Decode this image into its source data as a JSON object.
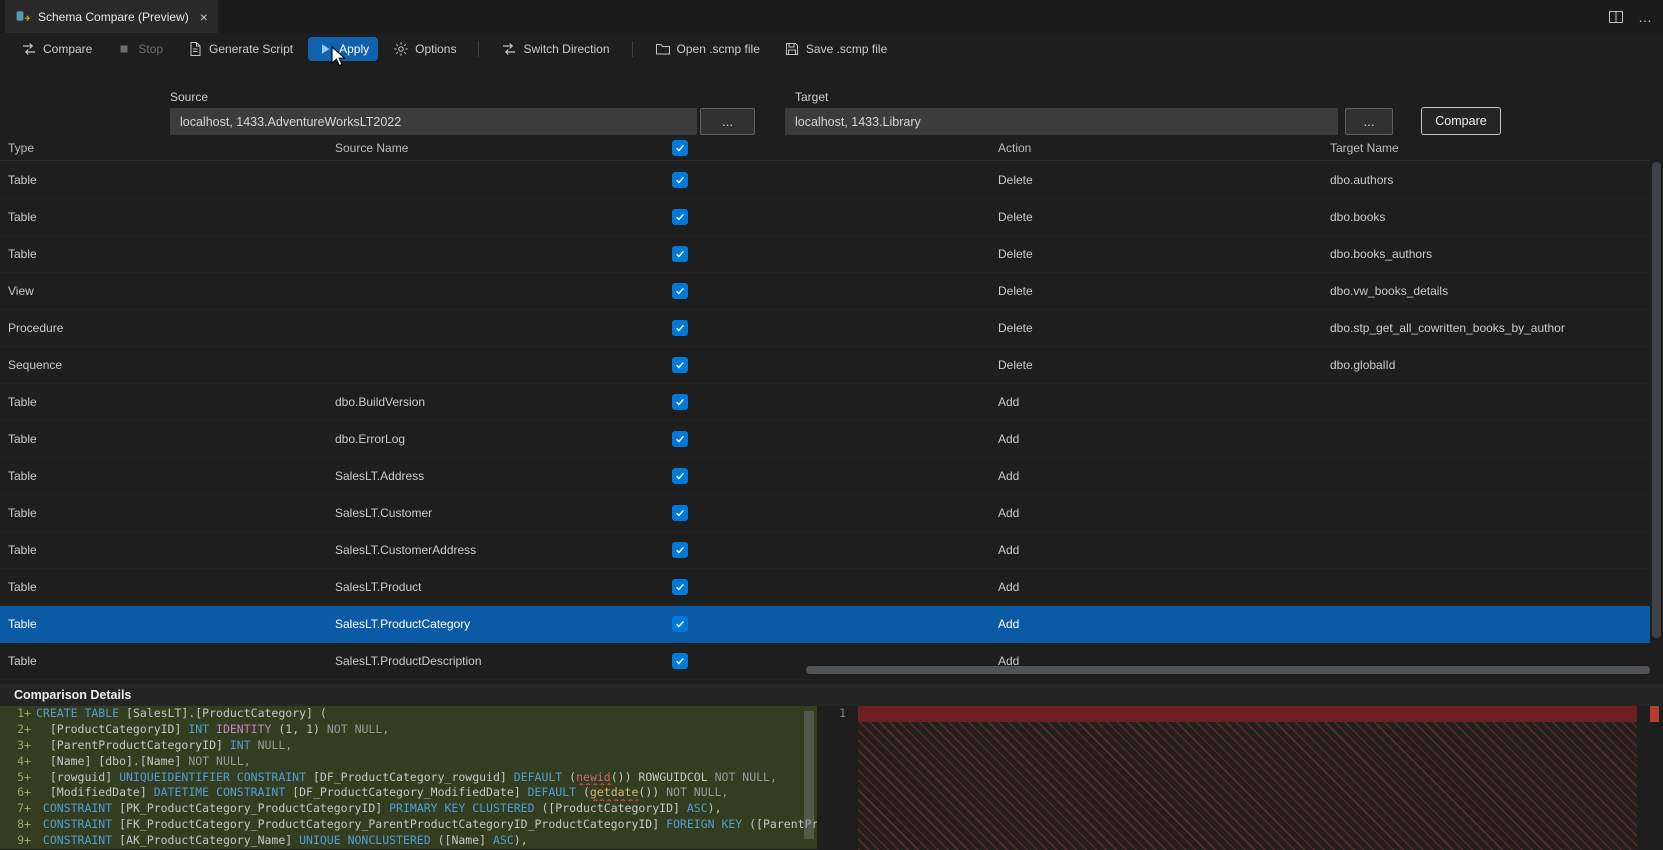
{
  "window": {
    "tab_title": "Schema Compare (Preview)",
    "close_glyph": "×",
    "more_glyph": "…"
  },
  "toolbar": {
    "items": [
      {
        "label": "Compare",
        "icon": "compare-icon"
      },
      {
        "label": "Stop",
        "icon": "stop-icon",
        "disabled": true
      },
      {
        "label": "Generate Script",
        "icon": "script-icon"
      },
      {
        "label": "Apply",
        "icon": "play-icon",
        "active": true
      },
      {
        "label": "Options",
        "icon": "gear-icon"
      },
      {
        "label": "Switch Direction",
        "icon": "switch-icon"
      },
      {
        "label": "Open .scmp file",
        "icon": "open-file-icon"
      },
      {
        "label": "Save .scmp file",
        "icon": "save-icon"
      }
    ]
  },
  "connections": {
    "source_label": "Source",
    "source_value": "localhost, 1433.AdventureWorksLT2022",
    "target_label": "Target",
    "target_value": "localhost, 1433.Library",
    "browse_label": "...",
    "compare_button": "Compare"
  },
  "grid": {
    "columns": [
      "Type",
      "Source Name",
      "Action",
      "Target Name"
    ],
    "select_all_checked": true,
    "selected_index": 12,
    "rows": [
      {
        "type": "Table",
        "source": "",
        "checked": true,
        "action": "Delete",
        "target": "dbo.authors"
      },
      {
        "type": "Table",
        "source": "",
        "checked": true,
        "action": "Delete",
        "target": "dbo.books"
      },
      {
        "type": "Table",
        "source": "",
        "checked": true,
        "action": "Delete",
        "target": "dbo.books_authors"
      },
      {
        "type": "View",
        "source": "",
        "checked": true,
        "action": "Delete",
        "target": "dbo.vw_books_details"
      },
      {
        "type": "Procedure",
        "source": "",
        "checked": true,
        "action": "Delete",
        "target": "dbo.stp_get_all_cowritten_books_by_author"
      },
      {
        "type": "Sequence",
        "source": "",
        "checked": true,
        "action": "Delete",
        "target": "dbo.globalId"
      },
      {
        "type": "Table",
        "source": "dbo.BuildVersion",
        "checked": true,
        "action": "Add",
        "target": ""
      },
      {
        "type": "Table",
        "source": "dbo.ErrorLog",
        "checked": true,
        "action": "Add",
        "target": ""
      },
      {
        "type": "Table",
        "source": "SalesLT.Address",
        "checked": true,
        "action": "Add",
        "target": ""
      },
      {
        "type": "Table",
        "source": "SalesLT.Customer",
        "checked": true,
        "action": "Add",
        "target": ""
      },
      {
        "type": "Table",
        "source": "SalesLT.CustomerAddress",
        "checked": true,
        "action": "Add",
        "target": ""
      },
      {
        "type": "Table",
        "source": "SalesLT.Product",
        "checked": true,
        "action": "Add",
        "target": ""
      },
      {
        "type": "Table",
        "source": "SalesLT.ProductCategory",
        "checked": true,
        "action": "Add",
        "target": ""
      },
      {
        "type": "Table",
        "source": "SalesLT.ProductDescription",
        "checked": true,
        "action": "Add",
        "target": ""
      }
    ]
  },
  "details": {
    "title": "Comparison Details",
    "right_line_num": "1",
    "left_lines": [
      {
        "num": "1",
        "segments": [
          [
            "kw",
            "CREATE TABLE "
          ],
          [
            "pl",
            "[SalesLT].[ProductCategory] ("
          ]
        ]
      },
      {
        "num": "2",
        "segments": [
          [
            "pl",
            "  [ProductCategoryID] "
          ],
          [
            "kw",
            "INT "
          ],
          [
            "mg",
            "IDENTITY "
          ],
          [
            "pl",
            "("
          ],
          [
            "nm",
            "1"
          ],
          [
            "pl",
            ", "
          ],
          [
            "nm",
            "1"
          ],
          [
            "pl",
            ") "
          ],
          [
            "dim",
            "NOT NULL,"
          ]
        ]
      },
      {
        "num": "3",
        "segments": [
          [
            "pl",
            "  [ParentProductCategoryID] "
          ],
          [
            "kw",
            "INT "
          ],
          [
            "dim",
            "NULL,"
          ]
        ]
      },
      {
        "num": "4",
        "segments": [
          [
            "pl",
            "  [Name] [dbo].[Name] "
          ],
          [
            "dim",
            "NOT NULL,"
          ]
        ]
      },
      {
        "num": "5",
        "segments": [
          [
            "pl",
            "  [rowguid] "
          ],
          [
            "kw",
            "UNIQUEIDENTIFIER "
          ],
          [
            "kw",
            "CONSTRAINT "
          ],
          [
            "pl",
            "[DF_ProductCategory_rowguid] "
          ],
          [
            "kw",
            "DEFAULT "
          ],
          [
            "pl",
            "("
          ],
          [
            "fnr",
            "newid"
          ],
          [
            "pl",
            "()) "
          ],
          [
            "pl",
            "ROWGUIDCOL "
          ],
          [
            "dim",
            "NOT NULL,"
          ]
        ]
      },
      {
        "num": "6",
        "segments": [
          [
            "pl",
            "  [ModifiedDate] "
          ],
          [
            "kw",
            "DATETIME "
          ],
          [
            "kw",
            "CONSTRAINT "
          ],
          [
            "pl",
            "[DF_ProductCategory_ModifiedDate] "
          ],
          [
            "kw",
            "DEFAULT "
          ],
          [
            "pl",
            "("
          ],
          [
            "fno",
            "getdate"
          ],
          [
            "pl",
            "()) "
          ],
          [
            "dim",
            "NOT NULL,"
          ]
        ]
      },
      {
        "num": "7",
        "segments": [
          [
            "kw",
            " CONSTRAINT "
          ],
          [
            "pl",
            "[PK_ProductCategory_ProductCategoryID] "
          ],
          [
            "kw",
            "PRIMARY KEY CLUSTERED "
          ],
          [
            "pl",
            "([ProductCategoryID] "
          ],
          [
            "kw",
            "ASC"
          ],
          [
            "pl",
            "),"
          ]
        ]
      },
      {
        "num": "8",
        "segments": [
          [
            "kw",
            " CONSTRAINT "
          ],
          [
            "pl",
            "[FK_ProductCategory_ProductCategory_ParentProductCategoryID_ProductCategoryID] "
          ],
          [
            "kw",
            "FOREIGN KEY "
          ],
          [
            "pl",
            "([ParentProductCatego"
          ]
        ]
      },
      {
        "num": "9",
        "segments": [
          [
            "kw",
            " CONSTRAINT "
          ],
          [
            "pl",
            "[AK_ProductCategory_Name] "
          ],
          [
            "kw",
            "UNIQUE NONCLUSTERED "
          ],
          [
            "pl",
            "([Name] "
          ],
          [
            "kw",
            "ASC"
          ],
          [
            "pl",
            "),"
          ]
        ]
      }
    ]
  },
  "colors": {
    "accent_blue": "#0f62ab",
    "selection_blue": "#0c5aa6",
    "checkbox_blue": "#0079d8",
    "diff_added_bg": "#333d20",
    "diff_removed_bg": "#6d2020"
  }
}
